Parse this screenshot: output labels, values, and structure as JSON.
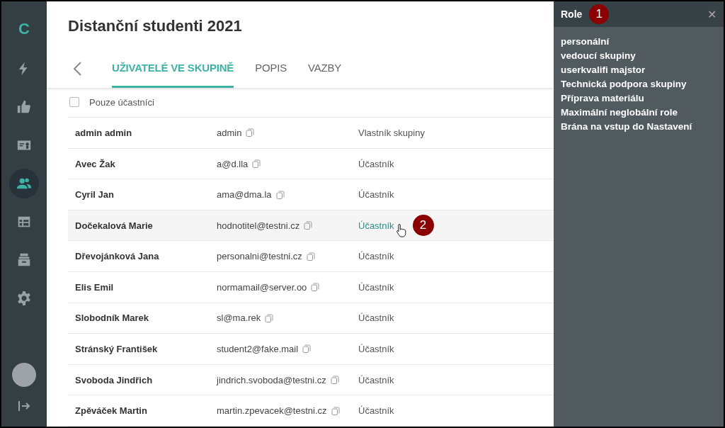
{
  "sidebar": {
    "logo": "C",
    "items": [
      {
        "kind": "bolt",
        "selected": false
      },
      {
        "kind": "thumb",
        "selected": false
      },
      {
        "kind": "card",
        "selected": false
      },
      {
        "kind": "users",
        "selected": true
      },
      {
        "kind": "table",
        "selected": false
      },
      {
        "kind": "archive",
        "selected": false
      },
      {
        "kind": "gear",
        "selected": false
      }
    ]
  },
  "title": "Distanční studenti 2021",
  "tabs": [
    {
      "label": "UŽIVATELÉ VE SKUPINĚ",
      "selected": true
    },
    {
      "label": "POPIS",
      "selected": false
    },
    {
      "label": "VAZBY",
      "selected": false
    }
  ],
  "filter": {
    "label": "Pouze účastníci",
    "checked": false
  },
  "rows": [
    {
      "name": "admin admin",
      "email": "admin",
      "role": "Vlastník skupiny",
      "hovered": false
    },
    {
      "name": "Avec Žak",
      "email": "a@d.lla",
      "role": "Účastník",
      "hovered": false
    },
    {
      "name": "Cyril Jan",
      "email": "ama@dma.la",
      "role": "Účastník",
      "hovered": false
    },
    {
      "name": "Dočekalová Marie",
      "email": "hodnotitel@testni.cz",
      "role": "Účastník",
      "hovered": true,
      "badge": "2"
    },
    {
      "name": "Dřevojánková Jana",
      "email": "personalni@testni.cz",
      "role": "Účastník",
      "hovered": false
    },
    {
      "name": "Elis Emil",
      "email": "normamail@server.oo",
      "role": "Účastník",
      "hovered": false
    },
    {
      "name": "Slobodník Marek",
      "email": "sl@ma.rek",
      "role": "Účastník",
      "hovered": false
    },
    {
      "name": "Stránský František",
      "email": "student2@fake.mail",
      "role": "Účastník",
      "hovered": false
    },
    {
      "name": "Svoboda Jindřich",
      "email": "jindrich.svoboda@testni.cz",
      "role": "Účastník",
      "hovered": false
    },
    {
      "name": "Zpěváček Martin",
      "email": "martin.zpevacek@testni.cz",
      "role": "Účastník",
      "hovered": false
    }
  ],
  "panel": {
    "title": "Role",
    "badge": "1",
    "close": "✕",
    "roles": [
      "personální",
      "vedoucí skupiny",
      "userkvalifi majstor",
      "Technická podpora skupiny",
      "Příprava materiálu",
      "Maximální neglobální role",
      "Brána na vstup do Nastavení"
    ]
  }
}
